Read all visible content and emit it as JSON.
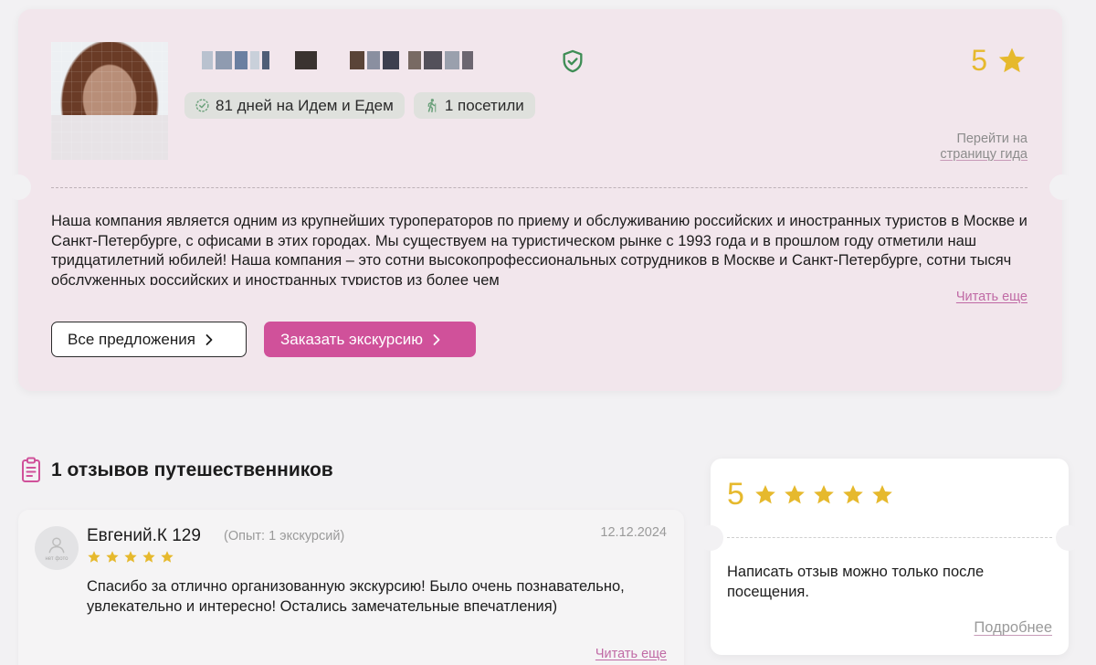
{
  "guide": {
    "badges": {
      "days": "81 дней на Идем и Едем",
      "visited": "1 посетили"
    },
    "rating": "5",
    "goto_link": {
      "line1": "Перейти на",
      "line2": "страницу гида"
    },
    "description": "Наша компания является одним из крупнейших туроператоров по приему и обслуживанию российских и иностранных туристов в Москве и Санкт-Петербурге, с офисами в этих городах. Мы существуем на туристическом рынке с 1993 года и в прошлом году отметили наш тридцатилетний юбилей! Наша компания – это сотни высокопрофессиональных сотрудников в Москве и Санкт-Петербурге, сотни тысяч обслуженных российских и иностранных туристов из более чем",
    "read_more": "Читать еще",
    "buttons": {
      "all_offers": "Все предложения",
      "book": "Заказать экскурсию"
    }
  },
  "reviews": {
    "title": "1 отзывов путешественников",
    "items": [
      {
        "name": "Евгений.К 129",
        "experience": "(Опыт: 1 экскурсий)",
        "date": "12.12.2024",
        "stars": 5,
        "avatar_placeholder": "нет фото",
        "text": "Спасибо за отлично организованную экскурсию! Было очень познавательно, увлекательно и интересно! Остались замечательные впечатления)",
        "read_more": "Читать еще"
      }
    ]
  },
  "summary": {
    "rating": "5",
    "stars": 5,
    "note": "Написать отзыв можно только после посещения.",
    "more_link": "Подробнее"
  },
  "colors": {
    "accent": "#d0519a",
    "star": "#e6b92d",
    "verified": "#3e8d55",
    "card_bg": "#f2e6ec",
    "page_bg": "#f2f1f3"
  },
  "icons": {
    "verified": "shield-check-icon",
    "rating_star": "star-icon",
    "days_badge": "check-circle-icon",
    "visited_badge": "hiker-icon",
    "chevron": "chevron-right-icon",
    "reviews": "clipboard-icon",
    "user_placeholder": "user-icon"
  }
}
